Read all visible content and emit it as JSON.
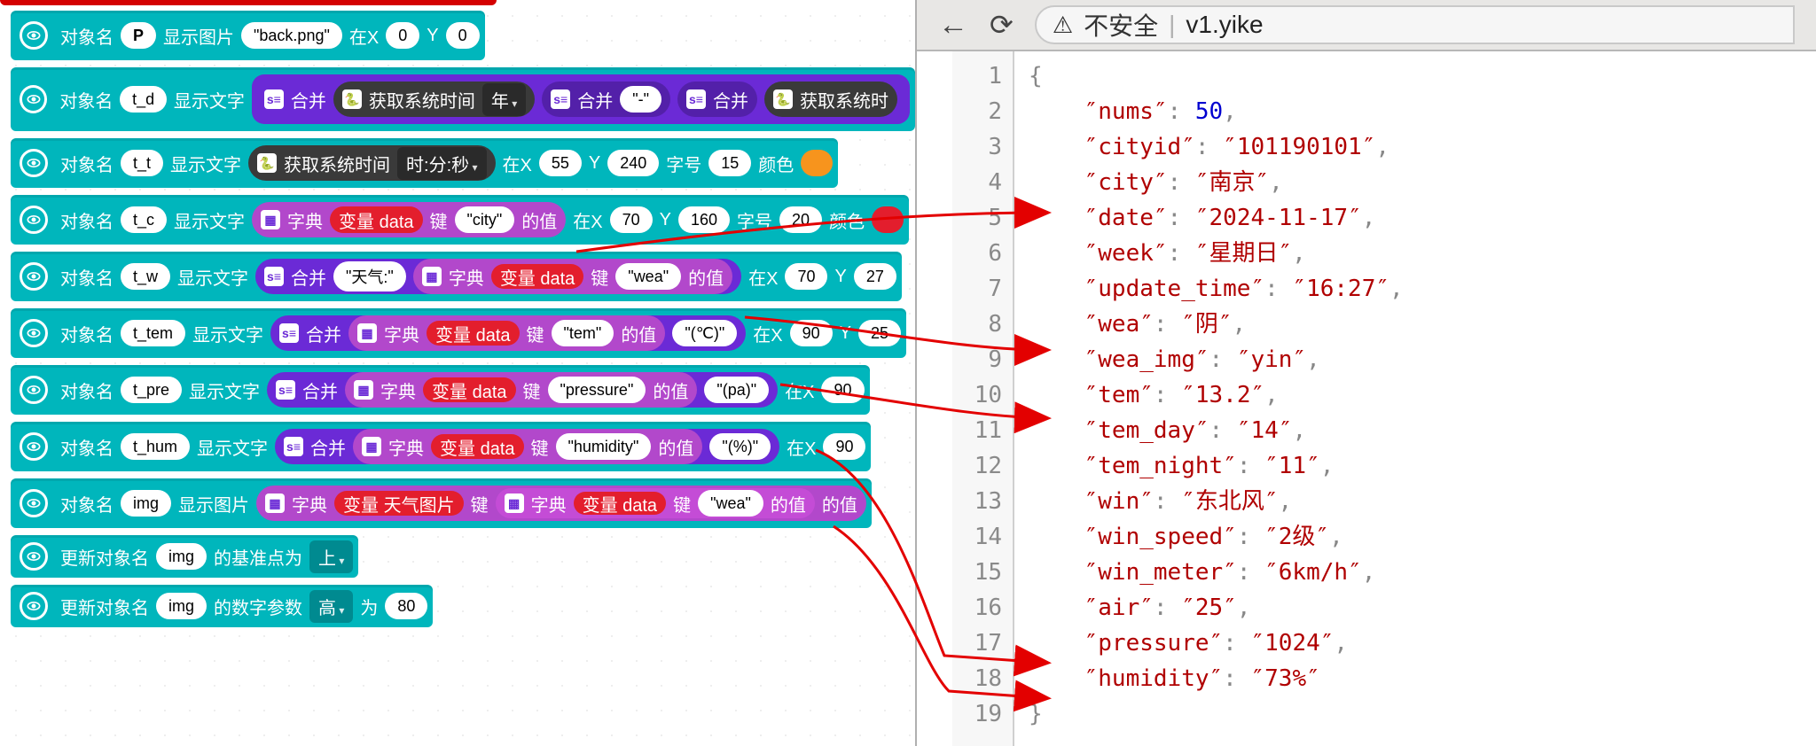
{
  "labels": {
    "objname": "对象名",
    "showimg": "显示图片",
    "showtext": "显示文字",
    "atX": "在X",
    "Y": "Y",
    "fontsize": "字号",
    "color": "颜色",
    "merge": "合并",
    "dict": "字典",
    "var_data": "变量 data",
    "var_weather_img": "变量 天气图片",
    "key": "键",
    "valueof": "的值",
    "get_sys_time": "获取系统时间",
    "year_dd": "年",
    "hms_dd": "时:分:秒",
    "update_anchor": "更新对象名",
    "anchor_to": "的基准点为",
    "up_dd": "上",
    "numparam": "的数字参数",
    "height_dd": "高",
    "to": "为",
    "dash": "-"
  },
  "rows": {
    "r1": {
      "obj": "P",
      "pill": "back.png",
      "x": "0",
      "y": "0"
    },
    "r2": {
      "obj": "t_d"
    },
    "r3": {
      "obj": "t_t",
      "x": "55",
      "y": "240",
      "fs": "15"
    },
    "r4": {
      "obj": "t_c",
      "key": "city",
      "x": "70",
      "y": "160",
      "fs": "20"
    },
    "r5": {
      "obj": "t_w",
      "prefix": "天气:",
      "key": "wea",
      "x": "70",
      "y": "27"
    },
    "r6": {
      "obj": "t_tem",
      "key": "tem",
      "unit": "(℃)",
      "x": "90",
      "y": "25"
    },
    "r7": {
      "obj": "t_pre",
      "key": "pressure",
      "unit": "(pa)",
      "x": "90"
    },
    "r8": {
      "obj": "t_hum",
      "key": "humidity",
      "unit": "(%)",
      "x": "90"
    },
    "r9": {
      "obj": "img",
      "key": "wea"
    },
    "r10": {
      "obj": "img"
    },
    "r11": {
      "obj": "img",
      "val": "80"
    }
  },
  "browser": {
    "back": "←",
    "reload": "⟳",
    "not_secure": "不安全",
    "url": "v1.yike"
  },
  "json": {
    "nums": 50,
    "cityid": "101190101",
    "city": "南京",
    "date": "2024-11-17",
    "week": "星期日",
    "update_time": "16:27",
    "wea": "阴",
    "wea_img": "yin",
    "tem": "13.2",
    "tem_day": "14",
    "tem_night": "11",
    "win": "东北风",
    "win_speed": "2级",
    "win_meter": "6km/h",
    "air": "25",
    "pressure": "1024",
    "humidity": "73%"
  },
  "lines": [
    1,
    2,
    3,
    4,
    5,
    6,
    7,
    8,
    9,
    10,
    11,
    12,
    13,
    14,
    15,
    16,
    17,
    18,
    19
  ]
}
